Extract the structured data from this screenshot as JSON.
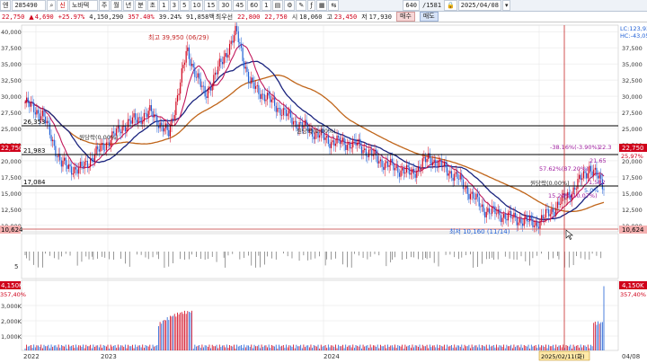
{
  "toolbar": {
    "stock_code": "285490",
    "stock_name": "노바텍",
    "prefix_label": "엔",
    "link_label": "신",
    "periods": [
      "주",
      "월",
      "년",
      "분",
      "초",
      "1",
      "3",
      "5",
      "10",
      "15",
      "30",
      "45",
      "60",
      "1"
    ],
    "count_value": "640",
    "total_value": "1581",
    "date_value": "2025/04/08"
  },
  "quote": {
    "price": "22,750",
    "arrow": "▲",
    "change": "4,690",
    "change_pct": "+25.97%",
    "volume": "4,150,290",
    "volume_ratio": "357.40%",
    "turnover_pct": "39.24%",
    "amount": "91,858백",
    "priority_label": "최우선",
    "bid": "22,800",
    "ask": "22,750",
    "open_label": "시",
    "open": "18,060",
    "high_label": "고",
    "high": "23,450",
    "low_label": "저",
    "low": "17,930",
    "buy_label": "매수",
    "sell_label": "매도"
  },
  "colors": {
    "up": "#d0021b",
    "down": "#1f5fd6",
    "ma_short": "#c2185b",
    "ma_mid": "#1a237e",
    "ma_long": "#c0651a",
    "grid": "#e3e3e3"
  },
  "chart": {
    "price_ticks": [
      "40,000",
      "37,500",
      "35,000",
      "32,500",
      "30,000",
      "27,500",
      "25,000",
      "22,500",
      "20,000",
      "17,500",
      "15,000",
      "12,500",
      "10,000"
    ],
    "right_ticks": [
      "37,500",
      "35,000",
      "32,500",
      "30,000",
      "27,500",
      "25,000",
      "22,500",
      "20,000",
      "17,500",
      "15,000",
      "12,500",
      "10,000"
    ],
    "volume_ticks": [
      "3,000K",
      "2,000K",
      "1,000K"
    ],
    "indicator_tick": "5",
    "x_labels": [
      "2022",
      "2023",
      "2024",
      "2025/02/11(화)",
      "04/08"
    ],
    "right_top_labels": [
      "LC:123,93",
      "HC:-43,05"
    ],
    "right_price_badge": "22,750",
    "right_pct_badge": "25,97%",
    "right_low_badge": "10,624",
    "left_price_badge": "22,750",
    "left_low_badge": "10,624",
    "right_volume_badge": "4,150K",
    "right_volume_pct": "357,40%",
    "left_volume_badge": "4,150K",
    "left_volume_pct": "357,40%",
    "support_lines": [
      {
        "label": "26,353",
        "value": 26353
      },
      {
        "label": "21,983",
        "value": 21983
      },
      {
        "label": "17,084",
        "value": 17084
      }
    ],
    "low_line_value": 10624,
    "annotations": {
      "high": "최고 39,950 (06/29)",
      "low": "최저 10,160 (11/14)",
      "touch1": "원당락(0.00%)",
      "touch2": "원당락(0.00%)",
      "touch3": "원당락(0.00%)",
      "pct_a": "-38.16%(-3.90%)",
      "pct_b": "57.62%(87.20%)",
      "pct_c": "21.65",
      "pct_d": "15.29%(10.07%)",
      "pct_e": "1,582",
      "pct_f": "5.0%",
      "pct_g": "22.3"
    }
  }
}
